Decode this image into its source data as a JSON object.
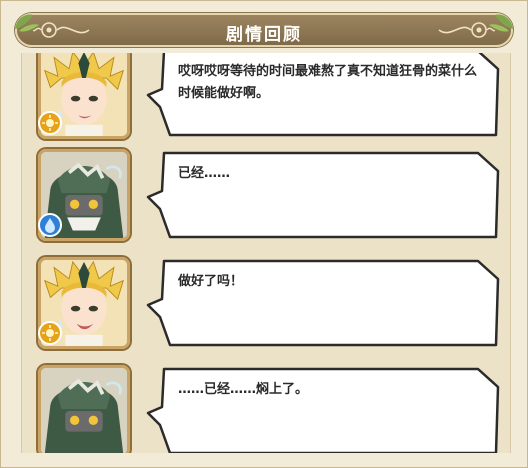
{
  "header": {
    "title": "剧情回顾"
  },
  "dialogue": [
    {
      "speaker_icon": "blonde-character-portrait",
      "badge_icon": "sun-icon",
      "badge_color": "#e8a21a",
      "text": "哎呀哎呀等待的时间最难熬了真不知道狂骨的菜什么时候能做好啊。"
    },
    {
      "speaker_icon": "masked-character-portrait",
      "badge_icon": "water-icon",
      "badge_color": "#2d7fd8",
      "text": "已经……"
    },
    {
      "speaker_icon": "blonde-character-portrait",
      "badge_icon": "sun-icon",
      "badge_color": "#e8a21a",
      "text": "做好了吗！"
    },
    {
      "speaker_icon": "masked-character-portrait",
      "badge_icon": "water-icon",
      "badge_color": "#2d7fd8",
      "text": "……已经……焖上了。"
    }
  ],
  "colors": {
    "title_bar": "#8e7754",
    "bubble_border": "#2b2b2b",
    "panel": "#ece2c8"
  }
}
